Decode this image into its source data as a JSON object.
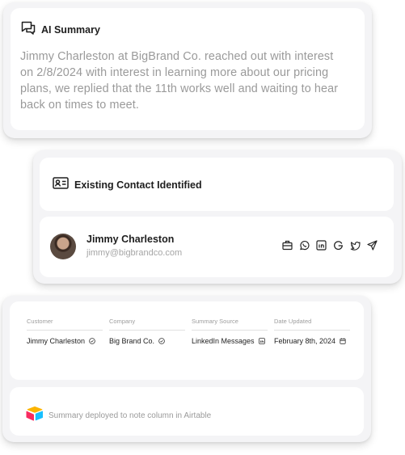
{
  "summary": {
    "title": "AI Summary",
    "icon": "chat-bubbles-icon",
    "text": "Jimmy Charleston at BigBrand Co. reached out with interest on 2/8/2024 with interest in learning more about our pricing plans, we replied that the 11th works well and waiting to hear back on times to meet."
  },
  "contact": {
    "header": "Existing Contact Identified",
    "icon": "contact-card-icon",
    "name": "Jimmy Charleston",
    "email": "jimmy@bigbrandco.com",
    "social_icons": [
      "briefcase-icon",
      "whatsapp-icon",
      "linkedin-icon",
      "google-icon",
      "twitter-icon",
      "send-icon"
    ]
  },
  "details": {
    "fields": [
      {
        "label": "Customer",
        "value": "Jimmy Charleston",
        "icon": "check-circle-icon"
      },
      {
        "label": "Company",
        "value": "Big Brand Co.",
        "icon": "check-circle-icon"
      },
      {
        "label": "Summary Source",
        "value": "LinkedIn Messages",
        "icon": "linkedin-small-icon"
      },
      {
        "label": "Date Updated",
        "value": "February 8th, 2024",
        "icon": "calendar-icon"
      }
    ],
    "note": "Summary deployed to note column in Airtable",
    "note_icon": "airtable-logo-icon"
  },
  "colors": {
    "card_bg": "#f4f4f6",
    "inner_bg": "#ffffff",
    "muted_text": "#9a9a9a",
    "airtable_yellow": "#fcb400",
    "airtable_red": "#f82b60",
    "airtable_blue": "#18bfff"
  }
}
